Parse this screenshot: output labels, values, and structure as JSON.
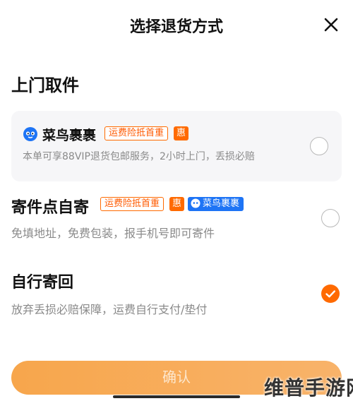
{
  "header": {
    "title": "选择退货方式",
    "close_icon": "close-icon"
  },
  "section": {
    "title": "上门取件"
  },
  "options": [
    {
      "name": "菜鸟裹裹",
      "tags": [
        "运费险抵首重",
        "惠"
      ],
      "desc": "本单可享88VIP退货包邮服务，2小时上门，丢损必赔",
      "selected": false
    },
    {
      "name": "寄件点自寄",
      "tags": [
        "运费险抵首重",
        "惠",
        "菜鸟裹裹"
      ],
      "desc": "免填地址，免费包装，报手机号即可寄件",
      "selected": false
    },
    {
      "name": "自行寄回",
      "desc": "放弃丢损必赔保障，运费自行支付/垫付",
      "selected": true
    }
  ],
  "confirm_label": "确认",
  "watermark": "维普手游网",
  "colors": {
    "accent": "#ff6a00",
    "brand_blue": "#1e74f5",
    "muted_text": "#8a8a8a",
    "card_bg": "#f6f6f8"
  }
}
